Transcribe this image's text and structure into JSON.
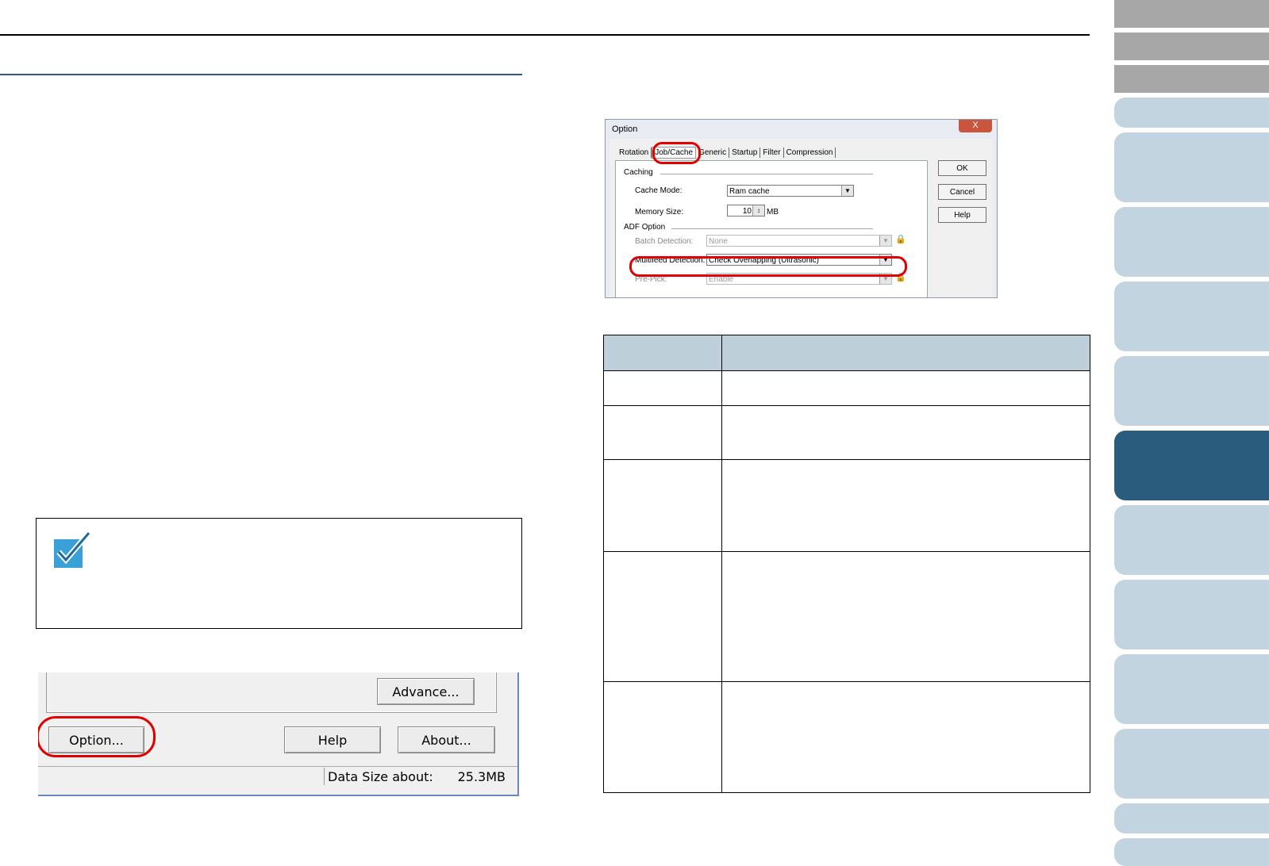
{
  "option_dialog": {
    "title": "Option",
    "close": "X",
    "tabs": [
      "Rotation",
      "Job/Cache",
      "Generic",
      "Startup",
      "Filter",
      "Compression"
    ],
    "caching": {
      "group": "Caching",
      "cache_mode_label": "Cache Mode:",
      "cache_mode_value": "Ram cache",
      "memory_size_label": "Memory Size:",
      "memory_size_value": "10",
      "memory_unit": "MB"
    },
    "adf": {
      "group": "ADF Option",
      "batch_detection_label": "Batch Detection:",
      "batch_detection_value": "None",
      "multifeed_label": "Multifeed Detection:",
      "multifeed_value": "Check Overlapping (Ultrasonic)",
      "prepick_label": "Pre-Pick:",
      "prepick_value": "Enable"
    },
    "buttons": {
      "ok": "OK",
      "cancel": "Cancel",
      "help": "Help"
    }
  },
  "scan_dialog": {
    "advance_button": "Advance...",
    "option_button": "Option...",
    "help_button": "Help",
    "about_button": "About...",
    "data_size_label": "Data Size about:",
    "data_size_value": "25.3MB"
  }
}
